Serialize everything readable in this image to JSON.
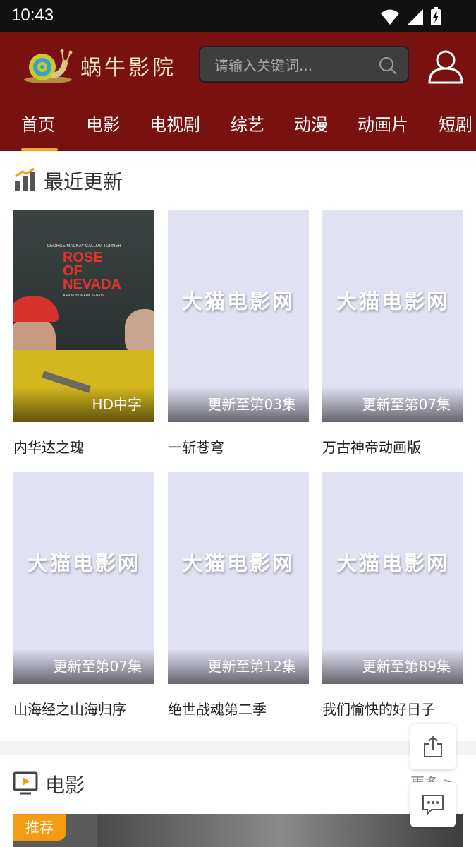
{
  "status_bar": {
    "time": "10:43"
  },
  "header": {
    "site_name": "蜗牛影院",
    "search_placeholder": "请输入关键词..."
  },
  "nav": {
    "items": [
      {
        "label": "首页",
        "active": true
      },
      {
        "label": "电影"
      },
      {
        "label": "电视剧"
      },
      {
        "label": "综艺"
      },
      {
        "label": "动漫"
      },
      {
        "label": "动画片"
      },
      {
        "label": "短剧"
      }
    ]
  },
  "recent": {
    "title": "最近更新",
    "watermark": "大猫电影网",
    "items": [
      {
        "title": "内华达之瑰",
        "badge": "HD中字"
      },
      {
        "title": "一斩苍穹",
        "badge": "更新至第03集"
      },
      {
        "title": "万古神帝动画版",
        "badge": "更新至第07集"
      },
      {
        "title": "山海经之山海归序",
        "badge": "更新至第07集"
      },
      {
        "title": "绝世战魂第二季",
        "badge": "更新至第12集"
      },
      {
        "title": "我们愉快的好日子",
        "badge": "更新至第89集"
      }
    ]
  },
  "poster_1": {
    "credits": "GEORGE MACKAY    CALLUM TURNER",
    "film_title_line1": "ROSE",
    "film_title_line2": "OF",
    "film_title_line3": "NEVADA",
    "film_by": "A FILM BY MARK JENKIN"
  },
  "movies": {
    "title": "电影",
    "more_label": "更多 >",
    "recommend_badge": "推荐"
  },
  "colors": {
    "header_bg": "#7a1111",
    "nav_active_underline": "#f6a623",
    "recommend_badge": "#f39c12",
    "placeholder_poster": "#e1e1f4"
  },
  "icons": [
    "wifi-icon",
    "signal-icon",
    "battery-charging-icon",
    "snail-logo-icon",
    "search-icon",
    "user-icon",
    "chart-bars-icon",
    "movie-screen-icon",
    "share-icon",
    "comment-icon"
  ]
}
